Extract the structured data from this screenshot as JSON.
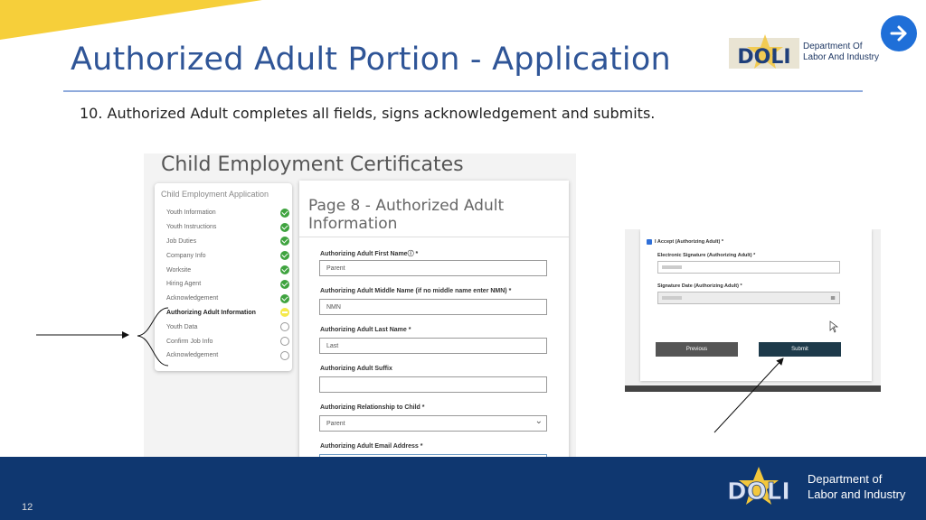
{
  "slide": {
    "title": "Authorized Adult Portion  - Application",
    "subtitle": "10. Authorized Adult completes all fields, signs acknowledgement and submits.",
    "page_number": "12",
    "logo_top": {
      "abbr": "DOLI",
      "line1": "Department Of",
      "line2": "Labor And Industry"
    },
    "logo_bottom": {
      "abbr": "DOLI",
      "line1": "Department of",
      "line2": "Labor and Industry"
    },
    "next_button_icon": "arrow-right-icon",
    "colors": {
      "title": "#2f5597",
      "accent": "#f6cf3a",
      "footer": "#0f3770",
      "next_button": "#1f6fd8"
    }
  },
  "screenshot1": {
    "app_title": "Child Employment Certificates",
    "nav": {
      "header": "Child Employment Application",
      "items": [
        {
          "label": "Youth Information",
          "status": "done"
        },
        {
          "label": "Youth Instructions",
          "status": "done"
        },
        {
          "label": "Job Duties",
          "status": "done"
        },
        {
          "label": "Company Info",
          "status": "done"
        },
        {
          "label": "Worksite",
          "status": "done"
        },
        {
          "label": "Hiring Agent",
          "status": "done"
        },
        {
          "label": "Acknowledgement",
          "status": "done"
        },
        {
          "label": "Authorizing Adult Information",
          "status": "current"
        },
        {
          "label": "Youth Data",
          "status": "empty"
        },
        {
          "label": "Confirm Job Info",
          "status": "empty"
        },
        {
          "label": "Acknowledgement",
          "status": "empty"
        }
      ]
    },
    "form": {
      "title": "Page 8 - Authorized Adult Information",
      "fields": [
        {
          "label": "Authorizing Adult First Nameⓘ *",
          "value": "Parent"
        },
        {
          "label": "Authorizing Adult Middle Name (if no middle name enter NMN) *",
          "value": "NMN"
        },
        {
          "label": "Authorizing Adult Last Name *",
          "value": "Last"
        },
        {
          "label": "Authorizing Adult Suffix",
          "value": ""
        },
        {
          "label": "Authorizing Relationship to Child *",
          "value": "Parent"
        },
        {
          "label": "Authorizing Adult Email Address *",
          "value": ""
        }
      ]
    }
  },
  "screenshot2": {
    "checkbox_label": "I Accept (Authorizing Adult) *",
    "signature_label": "Electronic Signature (Authorizing Adult) *",
    "date_label": "Signature Date (Authorizing Adult) *",
    "previous_label": "Previous",
    "submit_label": "Submit"
  }
}
